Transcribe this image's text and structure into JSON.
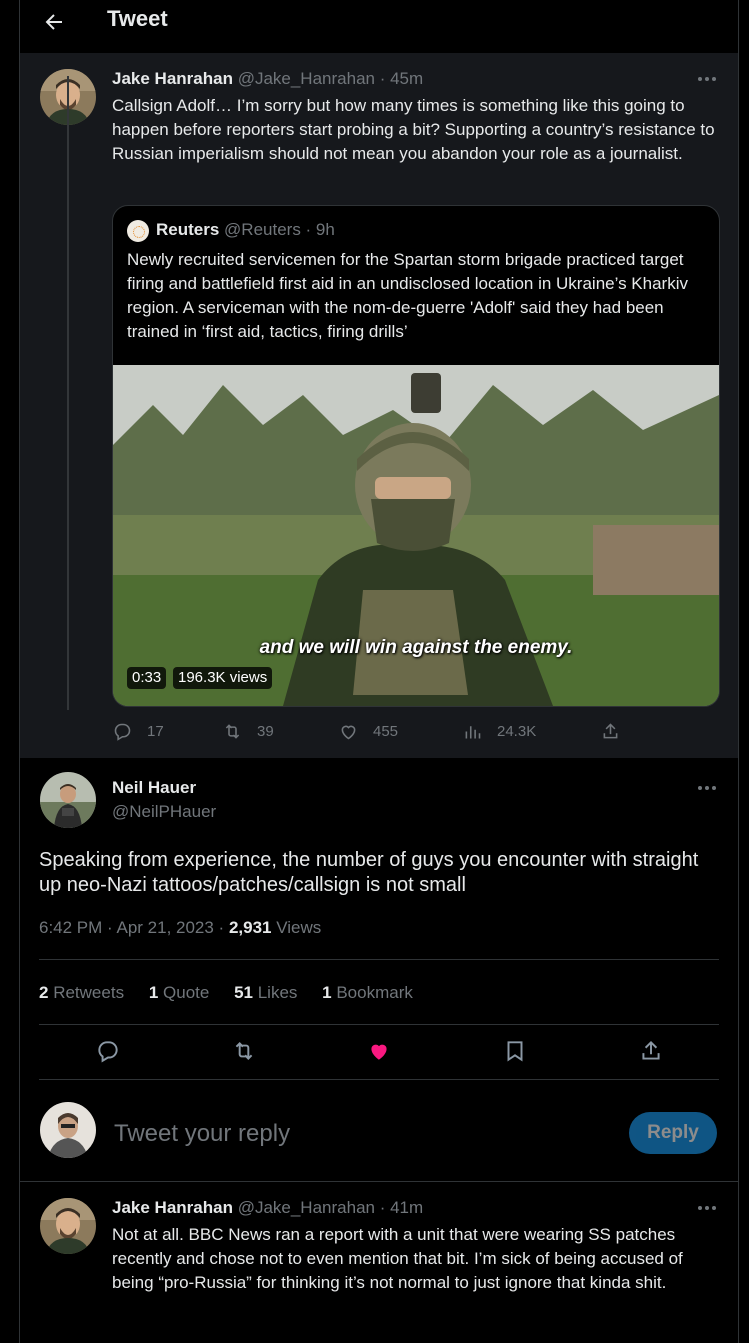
{
  "header": {
    "title": "Tweet"
  },
  "parent_tweet": {
    "author_name": "Jake Hanrahan",
    "author_meta": "@Jake_Hanrahan · 45m",
    "text": "Callsign Adolf… I’m sorry but how many times is something like this going to happen before reporters start probing a bit? Supporting a country’s resistance to Russian imperialism should not mean you abandon your role as a journalist.",
    "quote": {
      "author_name": "Reuters",
      "author_meta": "@Reuters · 9h",
      "text": "Newly recruited servicemen for the Spartan storm brigade practiced target firing and battlefield first aid in an undisclosed location in Ukraine’s Kharkiv region. A serviceman with the nom-de-guerre 'Adolf' said they had been trained in ‘first aid, tactics, firing drills’",
      "video": {
        "subtitle": "and we will win against the enemy.",
        "duration": "0:33",
        "views": "196.3K views"
      }
    },
    "actions": {
      "replies": "17",
      "retweets": "39",
      "likes": "455",
      "views": "24.3K"
    }
  },
  "main_tweet": {
    "author_name": "Neil Hauer",
    "author_handle": "@NeilPHauer",
    "text": "Speaking from experience, the number of guys you encounter with straight up neo-Nazi tattoos/patches/callsign is not small",
    "timestamp": "6:42 PM · Apr 21, 2023 · ",
    "views_count": "2,931",
    "views_label": " Views",
    "stats": {
      "retweets_count": "2",
      "retweets_label": "Retweets",
      "quotes_count": "1",
      "quotes_label": "Quote",
      "likes_count": "51",
      "likes_label": "Likes",
      "bookmarks_count": "1",
      "bookmarks_label": "Bookmark"
    }
  },
  "reply_box": {
    "placeholder": "Tweet your reply",
    "button": "Reply"
  },
  "reply_tweet": {
    "author_name": "Jake Hanrahan",
    "author_meta": "@Jake_Hanrahan · 41m",
    "text": "Not at all. BBC News ran a report with a unit that were wearing SS patches recently and chose not to even mention that bit. I’m sick of being accused of being “pro-Russia” for thinking it’s not normal to just ignore that kinda shit."
  },
  "colors": {
    "accent": "#1d9bf0",
    "like_active": "#f91880",
    "muted": "#71767b",
    "border": "#2f3336"
  },
  "icons": [
    "back-arrow-icon",
    "more-icon",
    "reply-icon",
    "retweet-icon",
    "like-icon",
    "views-icon",
    "share-icon",
    "bookmark-icon"
  ]
}
